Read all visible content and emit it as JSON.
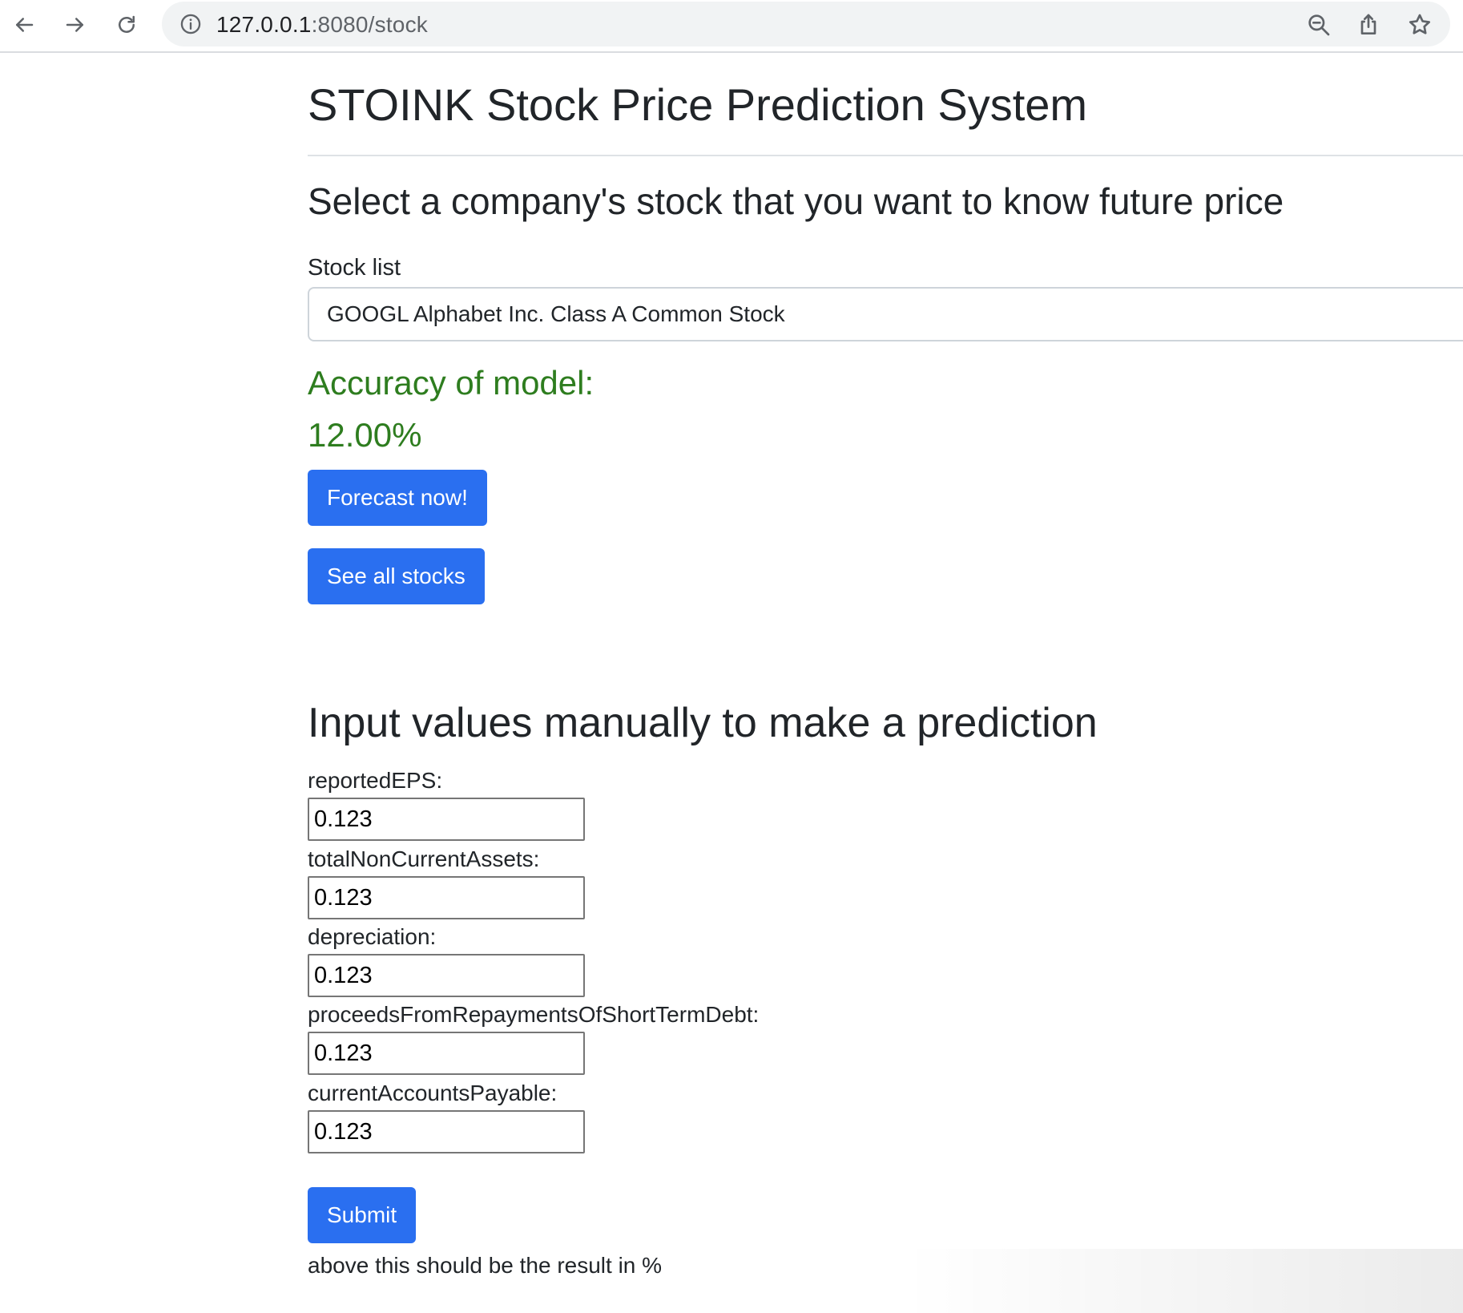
{
  "browser": {
    "url_host": "127.0.0.1",
    "url_path": ":8080/stock"
  },
  "page": {
    "title": "STOINK Stock Price Prediction System",
    "select_heading": "Select a company's stock that you want to know future price",
    "stock_label": "Stock list",
    "stock_selected": "GOOGL Alphabet Inc. Class A Common Stock",
    "accuracy_label": "Accuracy of model:",
    "accuracy_value": "12.00%",
    "forecast_button": "Forecast now!",
    "see_all_button": "See all stocks",
    "manual_heading": "Input values manually to make a prediction",
    "fields": [
      {
        "label": "reportedEPS:",
        "value": "0.123"
      },
      {
        "label": "totalNonCurrentAssets:",
        "value": "0.123"
      },
      {
        "label": "depreciation:",
        "value": "0.123"
      },
      {
        "label": "proceedsFromRepaymentsOfShortTermDebt:",
        "value": "0.123"
      },
      {
        "label": "currentAccountsPayable:",
        "value": "0.123"
      }
    ],
    "submit_button": "Submit",
    "result_note": "above this should be the result in %"
  },
  "colors": {
    "accent_button": "#2a6ff0",
    "accuracy_text": "#2e7d1f"
  }
}
